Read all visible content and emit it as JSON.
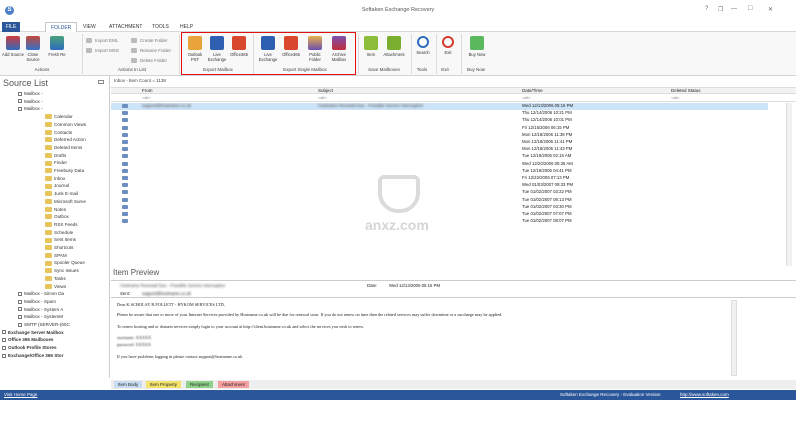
{
  "app": {
    "title": "Softaken Exchange Recovery"
  },
  "window_controls": {
    "help": "?",
    "restore": "❐",
    "minimize": "—",
    "maximize": "□",
    "close": "✕"
  },
  "menu": {
    "items": [
      "FILE",
      "FOLDER",
      "VIEW",
      "ATTACHMENT",
      "TOOLS",
      "HELP"
    ],
    "active": "FOLDER"
  },
  "ribbon": {
    "actions": {
      "buttons": [
        "Add Source",
        "Close Source",
        "Fresh Re"
      ],
      "group_label": "Actions"
    },
    "actions_in_list": {
      "buttons": [
        "Import EML",
        "Import MSG",
        "Create Folder",
        "Rename Folder",
        "Delete Folder"
      ],
      "group_label": "Actions In List"
    },
    "export_mailbox": {
      "buttons": [
        "Outlook PST",
        "Live Exchange",
        "Office365"
      ],
      "group_label": "Export Mailbox"
    },
    "export_single_mailbox": {
      "buttons": [
        "Live Exchange",
        "Office365",
        "Public Folder",
        "Archive Mailbox"
      ],
      "group_label": "Export Single Mailbox"
    },
    "save_mailboxes": {
      "buttons": [
        "Item",
        "Attachment"
      ],
      "group_label": "Save Mailboxes"
    },
    "tools": {
      "buttons": [
        "Search"
      ],
      "group_label": "Tools"
    },
    "exit": {
      "buttons": [
        "Exit"
      ],
      "group_label": "Exit"
    },
    "buy_now": {
      "buttons": [
        "Buy Now"
      ],
      "group_label": "Buy Now"
    }
  },
  "source_list": {
    "title": "Source List",
    "nodes": [
      "Mailbox - ",
      "Mailbox - ",
      "Mailbox - ",
      "Calendar",
      "Common Views",
      "Contacts",
      "Deferred Action",
      "Deleted Items",
      "Drafts",
      "Finder",
      "Freebusy Data",
      "Inbox",
      "Journal",
      "Junk E-mail",
      "Microsoft Surve",
      "Notes",
      "Outbox",
      "RSS Feeds",
      "Schedule",
      "Sent Items",
      "Shortcuts",
      "SPAM",
      "Spooler Queue",
      "Sync Issues",
      "Tasks",
      "Views",
      "Mailbox - Simon Da",
      "Mailbox - Spam",
      "Mailbox - System A",
      "Mailbox - SystemM",
      "SMTP (SERVER-(60C",
      "Exchange Server Mailbox",
      "Office 365 Mailboxes",
      "Outlook Profile Stores",
      "Exchange/Office 365 Stor"
    ]
  },
  "grid": {
    "breadcrumb": "Inbox - Item Count = 1138",
    "columns": [
      "From",
      "Subject",
      "Date/Time",
      "Deleted Status"
    ],
    "filter_placeholder": "<all>",
    "rows": [
      {
        "date": "Wed 12/13/2006 05:15 PM",
        "subject": "Hostname Renewal Due - Possible Service Interruption",
        "from": "support@hostname.co.uk"
      },
      {
        "date": "Thu 12/14/2006 10:21 PM",
        "subject": "",
        "from": ""
      },
      {
        "date": "Thu 12/14/2006 10:01 PM",
        "subject": "",
        "from": ""
      },
      {
        "date": "Fri 12/15/2006 06:15 PM",
        "subject": "",
        "from": ""
      },
      {
        "date": "Mon 12/18/2006 11:38 PM",
        "subject": "",
        "from": ""
      },
      {
        "date": "Mon 12/18/2006 11:41 PM",
        "subject": "",
        "from": ""
      },
      {
        "date": "Mon 12/18/2006 11:43 PM",
        "subject": "",
        "from": ""
      },
      {
        "date": "Tue 12/19/2006 02:15 AM",
        "subject": "",
        "from": ""
      },
      {
        "date": "Wed 12/20/2006 05:36 AM",
        "subject": "",
        "from": ""
      },
      {
        "date": "Tue 12/19/2006 04:41 PM",
        "subject": "",
        "from": ""
      },
      {
        "date": "Fri 12/22/2006 07:13 PM",
        "subject": "",
        "from": ""
      },
      {
        "date": "Wed 01/03/2007 09:33 PM",
        "subject": "",
        "from": ""
      },
      {
        "date": "Tue 01/02/2007 03:22 PM",
        "subject": "",
        "from": ""
      },
      {
        "date": "Tue 01/02/2007 08:13 PM",
        "subject": "",
        "from": ""
      },
      {
        "date": "Tue 01/02/2007 03:30 PM",
        "subject": "",
        "from": ""
      },
      {
        "date": "Tue 01/02/2007 07:07 PM",
        "subject": "",
        "from": ""
      },
      {
        "date": "Tue 01/02/2007 08:07 PM",
        "subject": "",
        "from": ""
      }
    ]
  },
  "preview": {
    "title": "Item Preview",
    "subject_value": "Hostname Renewal Due - Possible Service Interruption",
    "date_label": "Date:",
    "date_value": "Wed 12/13/2006 05:15 PM",
    "sent_label": "Sent:",
    "sent_value": "support@hostname.co.uk",
    "body_greeting": "Dear K.SCHOLAY R.FOLLETT - HYKOM SERVICES LTD,",
    "body_line1": "Please be aware that one or more of your Internet Services provided by Hostname.co.uk will be due for renewal soon. If you do not renew on time then the related services may suffer downtime or a surcharge may be applied.",
    "body_line2": "To renew hosting and or domain services simply login to your account at http://client.hostname.co.uk and select the services you wish to renew.",
    "body_user": "username: XXXXX",
    "body_pass": "password: XXXXX",
    "body_line3": "If you have problems logging in please contact support@hostname.co.uk"
  },
  "tabs": {
    "items": [
      "Item Body",
      "Item Property",
      "Recipient",
      "Attachment"
    ],
    "colors": [
      "#c9ddf2",
      "#f3e36b",
      "#8fd18b",
      "#f5a0a0"
    ]
  },
  "status": {
    "left": "Visit Home Page",
    "center": "Softaken Exchange Recovery - Evaluation Version",
    "right": "http://www.softaken.com"
  },
  "watermark": {
    "text": "anxz.com"
  },
  "colors": {
    "accent": "#2b579a",
    "highlight_box": "#e01010",
    "selected_row": "#cde3f7"
  }
}
